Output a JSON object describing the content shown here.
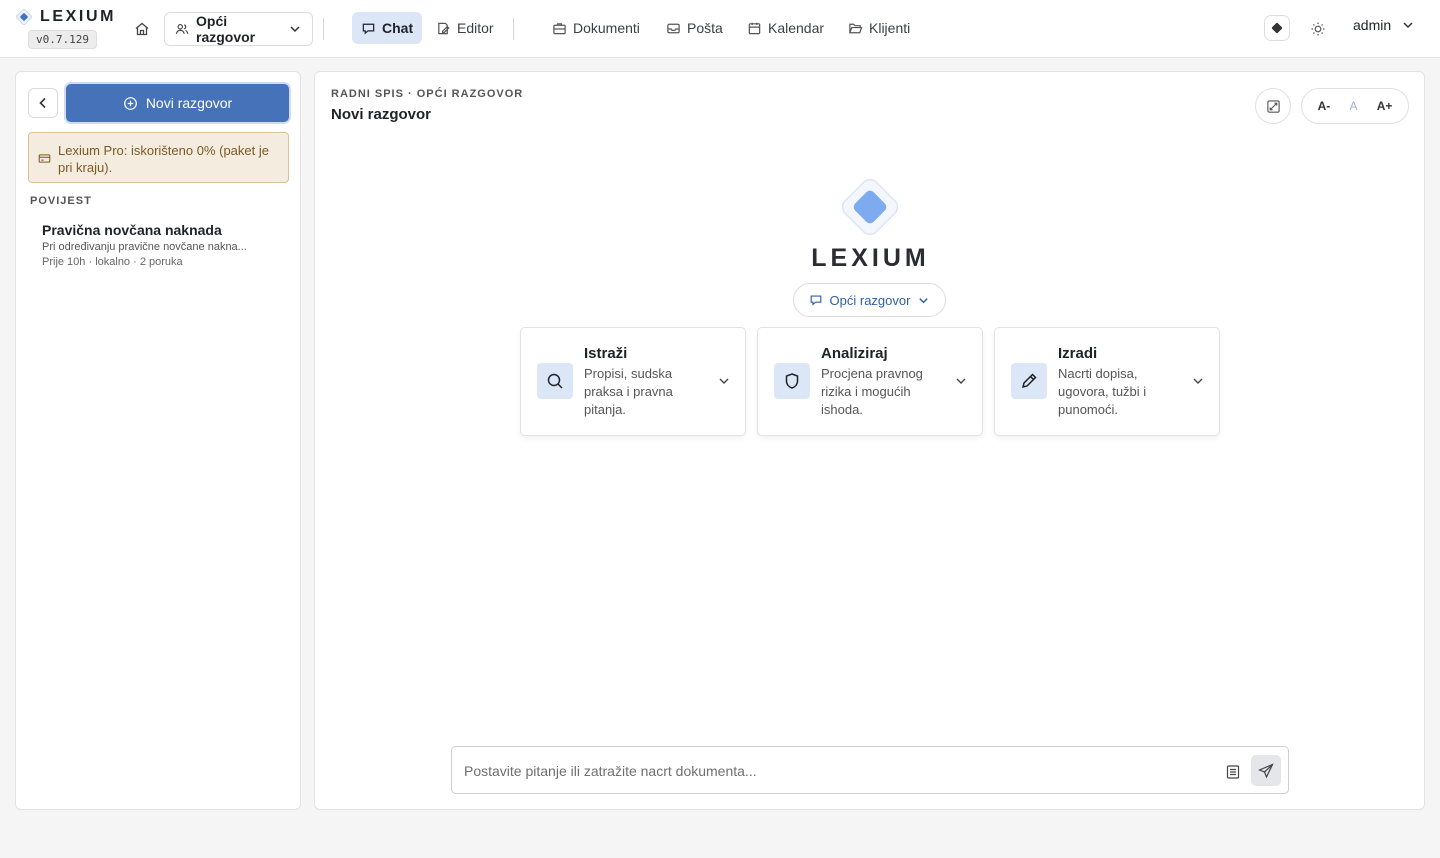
{
  "app": {
    "name": "LEXIUM",
    "version": "v0.7.129"
  },
  "topbar": {
    "mode_label": "Opći razgovor",
    "nav": [
      {
        "label": "Chat",
        "icon": "chat-bubble-icon",
        "active": true
      },
      {
        "label": "Editor",
        "icon": "edit-note-icon",
        "active": false
      },
      {
        "label": "Dokumenti",
        "icon": "briefcase-icon",
        "active": false
      },
      {
        "label": "Pošta",
        "icon": "mail-inbox-icon",
        "active": false
      },
      {
        "label": "Kalendar",
        "icon": "calendar-icon",
        "active": false
      },
      {
        "label": "Klijenti",
        "icon": "folder-open-icon",
        "active": false
      }
    ],
    "user": "admin"
  },
  "sidebar": {
    "new_chat_label": "Novi razgovor",
    "quota_text": "Lexium Pro: iskorišteno 0% (paket je pri kraju).",
    "history_title": "POVIJEST",
    "history": [
      {
        "title": "Pravična novčana naknada",
        "snippet": "Pri određivanju pravične novčane nakna...",
        "meta": "Prije 10h · lokalno · 2 poruka"
      }
    ]
  },
  "main": {
    "breadcrumb": "RADNI SPIS · OPĆI RAZGOVOR",
    "title": "Novi razgovor",
    "font_controls": {
      "smaller": "A-",
      "normal": "A",
      "larger": "A+"
    },
    "hero_word": "LEXIUM",
    "hero_mode_label": "Opći razgovor",
    "cards": [
      {
        "title": "Istraži",
        "desc": "Propisi, sudska praksa i pravna pitanja.",
        "icon": "search-icon"
      },
      {
        "title": "Analiziraj",
        "desc": "Procjena pravnog rizika i mogućih ishoda.",
        "icon": "shield-icon"
      },
      {
        "title": "Izradi",
        "desc": "Nacrti dopisa, ugovora, tužbi i punomoći.",
        "icon": "pencil-icon"
      }
    ],
    "composer_placeholder": "Postavite pitanje ili zatražite nacrt dokumenta..."
  },
  "colors": {
    "accent": "#4572b8",
    "accent_light": "#dbe6f7",
    "quota_bg": "#f4ecdf",
    "quota_text": "#7a5a25"
  }
}
